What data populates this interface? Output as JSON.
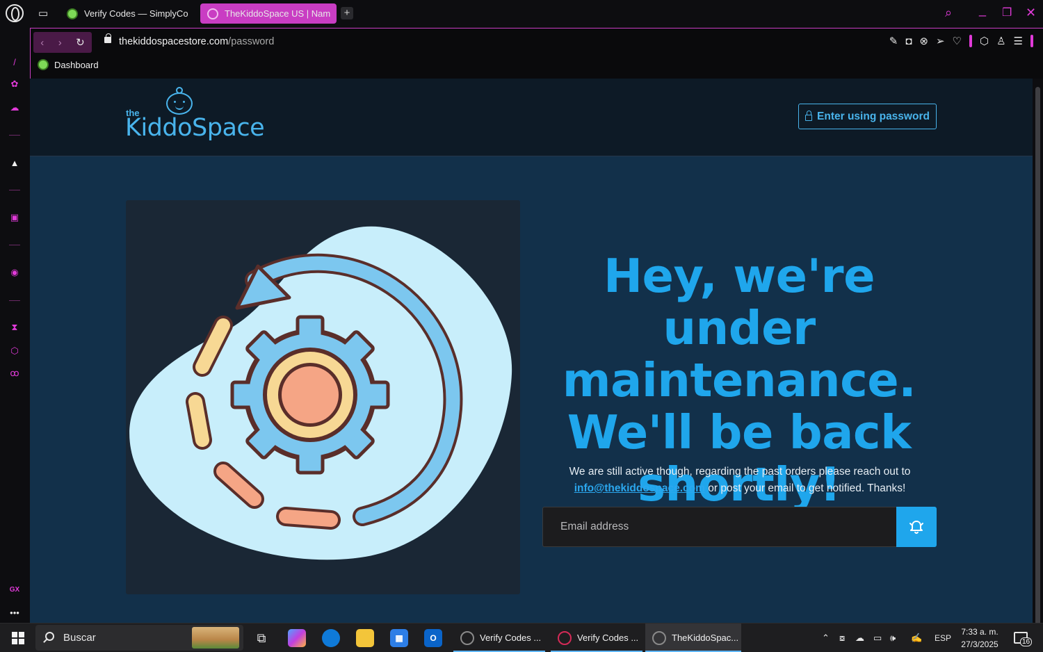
{
  "browser": {
    "tabs": [
      {
        "label": "Verify Codes — SimplyCo",
        "active": false
      },
      {
        "label": "TheKiddoSpace US | Nam",
        "active": true
      }
    ],
    "new_tab_label": "+",
    "address": {
      "domain": "thekiddospacestore.com",
      "path": "/password"
    },
    "bookmarks": [
      {
        "label": "Dashboard"
      }
    ],
    "accent_color": "#c93dc3"
  },
  "page": {
    "logo": {
      "small": "the",
      "word": "KiddoSpace"
    },
    "password_button": "Enter using password",
    "headline": "Hey, we're under maintenance. We'll be back shortly!",
    "subtext_before": "We are still active though, regarding the past orders please reach out to",
    "email_link": "info@thekiddospace.com",
    "subtext_after": "or post your email to get notified. Thanks!",
    "email_placeholder": "Email address",
    "brand_color": "#1fa6ec",
    "background_color": "#12304a"
  },
  "taskbar": {
    "search_placeholder": "Buscar",
    "tasks": [
      {
        "label": "Verify Codes ...",
        "icon": "opera-gx-icon"
      },
      {
        "label": "Verify Codes ...",
        "icon": "opera-icon"
      },
      {
        "label": "TheKiddoSpac...",
        "icon": "opera-gx-icon",
        "active": true
      }
    ],
    "language": "ESP",
    "time": "7:33 a. m.",
    "date": "27/3/2025",
    "notifications": "16"
  }
}
